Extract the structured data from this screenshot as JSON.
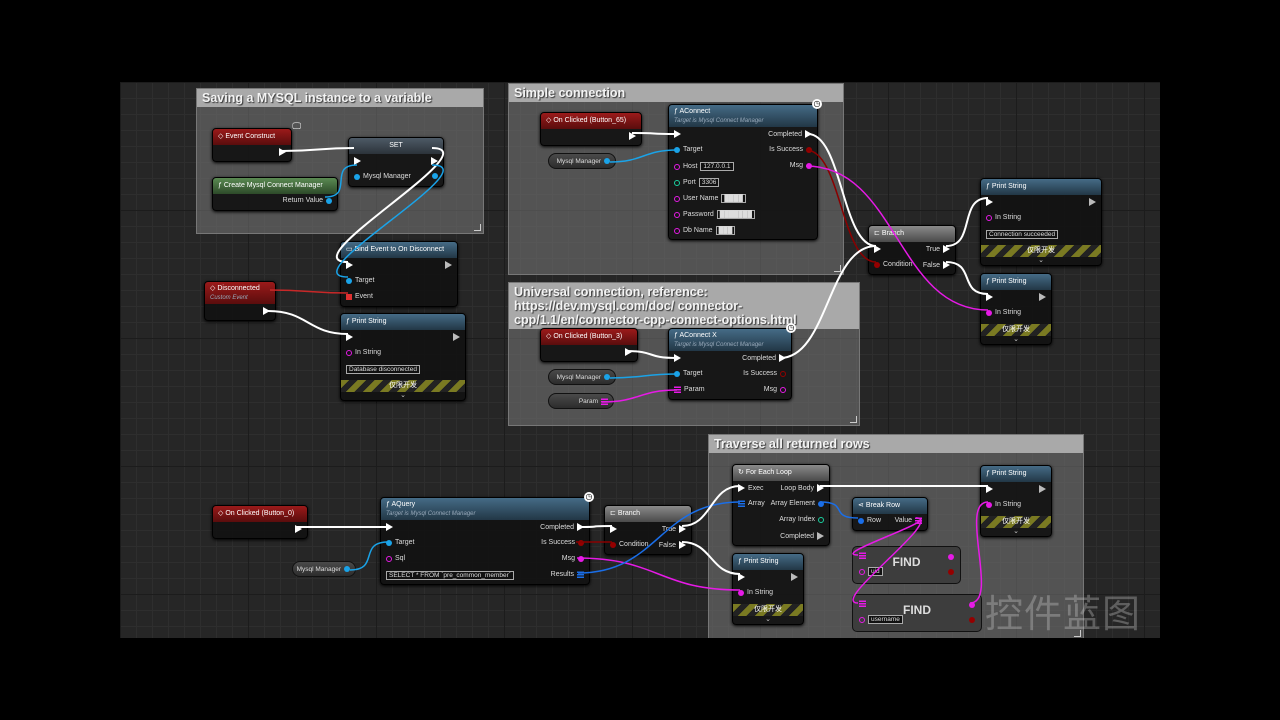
{
  "colors": {
    "exec": "#ffffff",
    "object": "#1aa3e8",
    "string": "#e61ae6",
    "int": "#1ad2a0",
    "bool": "#950000",
    "delegate": "#e03030",
    "array": "#1a6ee8"
  },
  "comments": [
    {
      "id": "c1",
      "title": "Saving a MYSQL instance to a variable"
    },
    {
      "id": "c2",
      "title": "Simple connection"
    },
    {
      "id": "c3",
      "title": "Universal connection, reference: https://dev.mysql.com/doc/ connector-cpp/1.1/en/connector-cpp-connect-options.html"
    },
    {
      "id": "c4",
      "title": "Traverse all returned rows"
    }
  ],
  "nodes": [
    {
      "id": "eventConstruct",
      "kind": "event",
      "icon": "event-diamond-icon",
      "title": "Event Construct",
      "rows": [
        {
          "r": {
            "pin": "exec"
          }
        }
      ]
    },
    {
      "id": "set",
      "kind": "set",
      "title": "SET",
      "rows": [
        {
          "l": {
            "pin": "exec"
          },
          "r": {
            "pin": "exec"
          }
        },
        {
          "l": {
            "pin": "object",
            "label": "Mysql Manager"
          },
          "r": {
            "pin": "object"
          }
        }
      ]
    },
    {
      "id": "createMgr",
      "kind": "green",
      "icon": "function-icon",
      "title": "Create Mysql Connect Manager",
      "rows": [
        {
          "r": {
            "pin": "object",
            "label": "Return Value"
          }
        }
      ]
    },
    {
      "id": "bindEvent",
      "kind": "func",
      "icon": "bind-event-icon",
      "title": "Bind Event to On Disconnect",
      "rows": [
        {
          "l": {
            "pin": "exec"
          },
          "r": {
            "pin": "exec-hollow"
          }
        },
        {
          "l": {
            "pin": "object",
            "label": "Target"
          }
        },
        {
          "l": {
            "pin": "delegate",
            "label": "Event"
          }
        }
      ]
    },
    {
      "id": "disconnected",
      "kind": "event",
      "icon": "event-diamond-icon",
      "title": "Disconnected",
      "subtitle": "Custom Event",
      "rows": [
        {
          "r": {
            "pin": "exec"
          }
        }
      ]
    },
    {
      "id": "print1",
      "kind": "func",
      "icon": "function-icon",
      "title": "Print String",
      "dev": "仅限开发",
      "rows": [
        {
          "l": {
            "pin": "exec"
          },
          "r": {
            "pin": "exec-hollow"
          }
        },
        {
          "l": {
            "pin": "string-hollow",
            "label": "In String"
          }
        },
        {
          "l": {
            "value": "Database disconnected"
          }
        }
      ]
    },
    {
      "id": "btn65",
      "kind": "event",
      "icon": "event-diamond-icon",
      "title": "On Clicked (Button_65)",
      "rows": [
        {
          "r": {
            "pin": "exec"
          }
        }
      ]
    },
    {
      "id": "aconnect",
      "kind": "func",
      "icon": "function-icon",
      "latent": true,
      "title": "AConnect",
      "subtitle": "Target is Mysql Connect Manager",
      "rows": [
        {
          "l": {
            "pin": "exec"
          },
          "r": {
            "pin": "exec",
            "label": "Completed"
          }
        },
        {
          "l": {
            "pin": "object",
            "label": "Target"
          },
          "r": {
            "pin": "bool",
            "label": "Is Success"
          }
        },
        {
          "l": {
            "pin": "string-hollow",
            "label": "Host",
            "value": "127.0.0.1"
          },
          "r": {
            "pin": "string",
            "label": "Msg"
          }
        },
        {
          "l": {
            "pin": "int-hollow",
            "label": "Port",
            "value": "3306"
          }
        },
        {
          "l": {
            "pin": "string-hollow",
            "label": "User Name",
            "value": "████"
          }
        },
        {
          "l": {
            "pin": "string-hollow",
            "label": "Password",
            "value": "███████"
          }
        },
        {
          "l": {
            "pin": "string-hollow",
            "label": "Db Name",
            "value": "███"
          }
        }
      ]
    },
    {
      "id": "btn3",
      "kind": "event",
      "icon": "event-diamond-icon",
      "title": "On Clicked (Button_3)",
      "rows": [
        {
          "r": {
            "pin": "exec"
          }
        }
      ]
    },
    {
      "id": "aconnectx",
      "kind": "func",
      "icon": "function-icon",
      "latent": true,
      "title": "AConnect X",
      "subtitle": "Target is Mysql Connect Manager",
      "rows": [
        {
          "l": {
            "pin": "exec"
          },
          "r": {
            "pin": "exec",
            "label": "Completed"
          }
        },
        {
          "l": {
            "pin": "object",
            "label": "Target"
          },
          "r": {
            "pin": "bool-hollow",
            "label": "Is Success"
          }
        },
        {
          "l": {
            "pin": "map",
            "label": "Param"
          },
          "r": {
            "pin": "string-hollow",
            "label": "Msg"
          }
        }
      ]
    },
    {
      "id": "branch1",
      "kind": "flow",
      "icon": "branch-icon",
      "title": "Branch",
      "rows": [
        {
          "l": {
            "pin": "exec"
          },
          "r": {
            "pin": "exec",
            "label": "True"
          }
        },
        {
          "l": {
            "pin": "bool",
            "label": "Condition"
          },
          "r": {
            "pin": "exec",
            "label": "False"
          }
        }
      ]
    },
    {
      "id": "printOk",
      "kind": "func",
      "icon": "function-icon",
      "title": "Print String",
      "dev": "仅限开发",
      "rows": [
        {
          "l": {
            "pin": "exec"
          },
          "r": {
            "pin": "exec-hollow"
          }
        },
        {
          "l": {
            "pin": "string-hollow",
            "label": "In String"
          }
        },
        {
          "l": {
            "value": "Connection succeeded"
          }
        }
      ]
    },
    {
      "id": "printFail",
      "kind": "func",
      "icon": "function-icon",
      "title": "Print String",
      "dev": "仅限开发",
      "rows": [
        {
          "l": {
            "pin": "exec"
          },
          "r": {
            "pin": "exec-hollow"
          }
        },
        {
          "l": {
            "pin": "string",
            "label": "In String"
          }
        }
      ]
    },
    {
      "id": "btn0",
      "kind": "event",
      "icon": "event-diamond-icon",
      "title": "On Clicked (Button_0)",
      "rows": [
        {
          "r": {
            "pin": "exec"
          }
        }
      ]
    },
    {
      "id": "aquery",
      "kind": "func",
      "icon": "function-icon",
      "latent": true,
      "title": "AQuery",
      "subtitle": "Target is Mysql Connect Manager",
      "rows": [
        {
          "l": {
            "pin": "exec"
          },
          "r": {
            "pin": "exec",
            "label": "Completed"
          }
        },
        {
          "l": {
            "pin": "object",
            "label": "Target"
          },
          "r": {
            "pin": "bool",
            "label": "Is Success"
          }
        },
        {
          "l": {
            "pin": "string-hollow",
            "label": "Sql"
          },
          "r": {
            "pin": "string",
            "label": "Msg"
          }
        },
        {
          "l": {
            "value": "SELECT * FROM `pre_common_member`"
          },
          "r": {
            "pin": "array",
            "label": "Results"
          }
        }
      ]
    },
    {
      "id": "branch2",
      "kind": "flow",
      "icon": "branch-icon",
      "title": "Branch",
      "rows": [
        {
          "l": {
            "pin": "exec"
          },
          "r": {
            "pin": "exec",
            "label": "True"
          }
        },
        {
          "l": {
            "pin": "bool",
            "label": "Condition"
          },
          "r": {
            "pin": "exec",
            "label": "False"
          }
        }
      ]
    },
    {
      "id": "foreach",
      "kind": "flow",
      "icon": "loop-icon",
      "title": "For Each Loop",
      "rows": [
        {
          "l": {
            "pin": "exec",
            "label": "Exec"
          },
          "r": {
            "pin": "exec",
            "label": "Loop Body"
          }
        },
        {
          "l": {
            "pin": "array",
            "label": "Array"
          },
          "r": {
            "pin": "array-el",
            "label": "Array Element"
          }
        },
        {
          "r": {
            "pin": "int-hollow",
            "label": "Array Index"
          }
        },
        {
          "r": {
            "pin": "exec-hollow",
            "label": "Completed"
          }
        }
      ]
    },
    {
      "id": "printRow",
      "kind": "func",
      "icon": "function-icon",
      "title": "Print String",
      "dev": "仅限开发",
      "rows": [
        {
          "l": {
            "pin": "exec"
          },
          "r": {
            "pin": "exec-hollow"
          }
        },
        {
          "l": {
            "pin": "string",
            "label": "In String"
          }
        }
      ]
    },
    {
      "id": "breakRow",
      "kind": "func",
      "icon": "break-struct-icon",
      "title": "Break Row",
      "rows": [
        {
          "l": {
            "pin": "array-el",
            "label": "Row"
          },
          "r": {
            "pin": "map",
            "label": "Value"
          }
        }
      ]
    },
    {
      "id": "printFalse",
      "kind": "func",
      "icon": "function-icon",
      "title": "Print String",
      "dev": "仅限开发",
      "rows": [
        {
          "l": {
            "pin": "exec"
          },
          "r": {
            "pin": "exec-hollow"
          }
        },
        {
          "l": {
            "pin": "string",
            "label": "In String"
          }
        }
      ]
    }
  ],
  "variables": [
    {
      "id": "var1",
      "label": "Mysql Manager",
      "pin": "object"
    },
    {
      "id": "var2",
      "label": "Mysql Manager",
      "pin": "object"
    },
    {
      "id": "var3",
      "label": "Param",
      "pin": "map"
    },
    {
      "id": "var4",
      "label": "Mysql Manager",
      "pin": "object"
    }
  ],
  "finds": [
    {
      "id": "find1",
      "label": "FIND",
      "key": "uid"
    },
    {
      "id": "find2",
      "label": "FIND",
      "key": "username"
    }
  ],
  "watermark": "控件蓝图"
}
